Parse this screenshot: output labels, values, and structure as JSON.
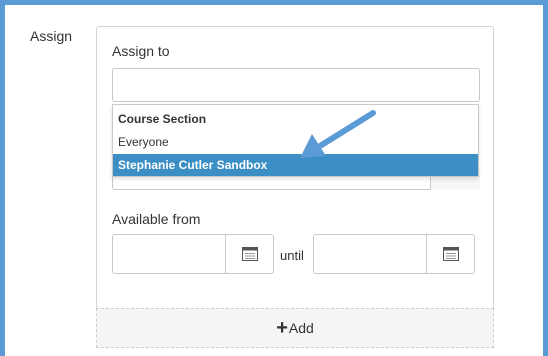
{
  "assign_section": {
    "label": "Assign"
  },
  "assign_to": {
    "label": "Assign to",
    "value": "",
    "dropdown": {
      "group_label": "Course Section",
      "options": [
        "Everyone",
        "Stephanie Cutler Sandbox"
      ],
      "highlighted": "Stephanie Cutler Sandbox"
    }
  },
  "available": {
    "label": "Available from",
    "from_value": "",
    "until_label": "until",
    "until_value": ""
  },
  "add_button": {
    "label": "Add"
  },
  "icons": {
    "calendar": "calendar-icon",
    "plus": "plus-icon",
    "annotation": "arrow-annotation-icon"
  },
  "colors": {
    "frame": "#5b9bd5",
    "highlight": "#3b8fc5",
    "arrow": "#5b9bd5"
  }
}
